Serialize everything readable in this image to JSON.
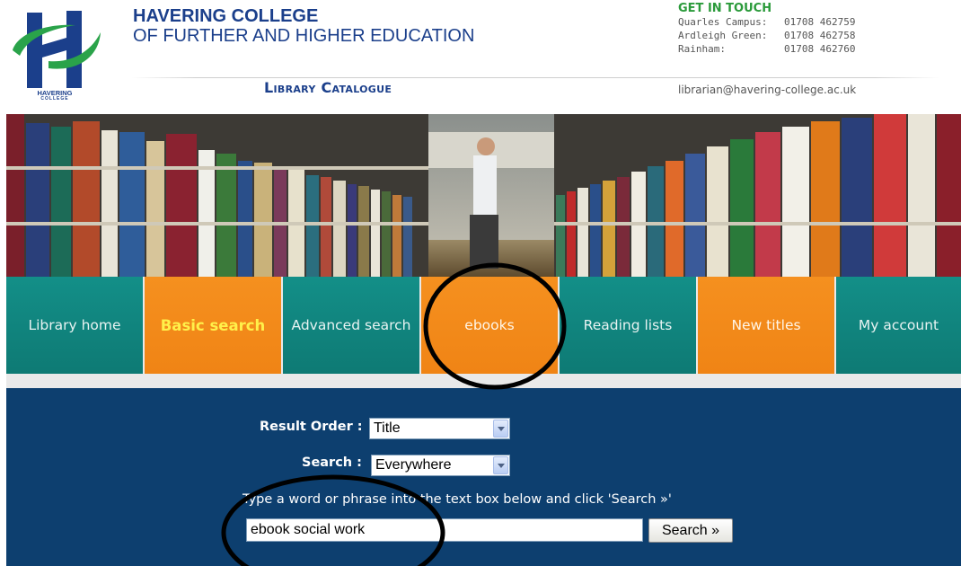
{
  "header": {
    "logo": {
      "caption_line1": "HAVERING",
      "caption_line2": "COLLEGE",
      "colors": {
        "blue": "#1b3f8b",
        "green": "#2aa34a"
      }
    },
    "college_name_line1": "HAVERING COLLEGE",
    "college_name_line2": "OF FURTHER AND HIGHER EDUCATION",
    "catalogue_title": "Library Catalogue",
    "contact": {
      "heading": "GET IN TOUCH",
      "rows": [
        {
          "label": "Quarles Campus:",
          "phone": "01708 462759"
        },
        {
          "label": "Ardleigh Green:",
          "phone": "01708 462758"
        },
        {
          "label": "Rainham:",
          "phone": "01708 462760"
        }
      ],
      "email": "librarian@havering-college.ac.uk"
    }
  },
  "nav": {
    "items": [
      {
        "label": "Library home",
        "color": "teal"
      },
      {
        "label": "Basic search",
        "color": "orange",
        "active": true
      },
      {
        "label": "Advanced search",
        "color": "teal"
      },
      {
        "label": "ebooks",
        "color": "orange"
      },
      {
        "label": "Reading lists",
        "color": "teal"
      },
      {
        "label": "New titles",
        "color": "orange"
      },
      {
        "label": "My account",
        "color": "teal"
      }
    ]
  },
  "search": {
    "result_order_label": "Result Order :",
    "result_order_value": "Title",
    "search_label": "Search :",
    "search_scope_value": "Everywhere",
    "instructions": "Type a word or phrase into the text box below and click 'Search »'",
    "query_value": "ebook social work",
    "button_label": "Search »"
  },
  "colors": {
    "teal": "#138f88",
    "orange": "#f5901f",
    "panel_blue": "#0d3f6f",
    "active_text": "#fff04a",
    "contact_heading": "#2a9a3a"
  }
}
